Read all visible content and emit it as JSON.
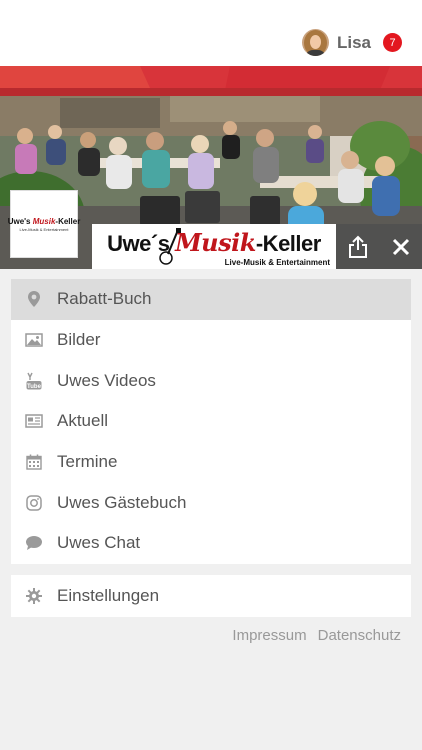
{
  "header": {
    "username": "Lisa",
    "notification_count": "7"
  },
  "brand": {
    "thumb_line1_a": "Uwe's ",
    "thumb_line1_b": "Musik",
    "thumb_line1_c": "-Keller",
    "thumb_line2": "Live-Musik & Entertainment",
    "banner_part1": "Uwe´s ",
    "banner_part2": "Musik",
    "banner_part3": "-Keller",
    "banner_sub": "Live-Musik & Entertainment"
  },
  "menu": {
    "items": [
      {
        "label": "Rabatt-Buch",
        "icon": "map-pin-icon"
      },
      {
        "label": "Bilder",
        "icon": "image-icon"
      },
      {
        "label": "Uwes Videos",
        "icon": "youtube-icon"
      },
      {
        "label": "Aktuell",
        "icon": "newspaper-icon"
      },
      {
        "label": "Termine",
        "icon": "calendar-icon"
      },
      {
        "label": "Uwes Gästebuch",
        "icon": "instagram-icon"
      },
      {
        "label": "Uwes Chat",
        "icon": "chat-bubble-icon"
      }
    ],
    "settings": {
      "label": "Einstellungen",
      "icon": "gear-icon"
    }
  },
  "footer": {
    "impressum": "Impressum",
    "datenschutz": "Datenschutz"
  },
  "colors": {
    "accent_red": "#e3171f",
    "brand_red": "#c0161c",
    "menu_active_bg": "#dcdcdc",
    "icon_gray": "#9a9a9a"
  }
}
